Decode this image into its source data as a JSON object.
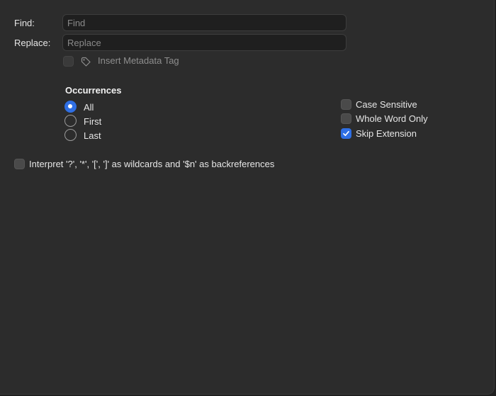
{
  "find": {
    "label": "Find:",
    "placeholder": "Find",
    "value": ""
  },
  "replace": {
    "label": "Replace:",
    "placeholder": "Replace",
    "value": ""
  },
  "metadata_tag": {
    "label": "Insert Metadata Tag",
    "checked": false,
    "enabled": false,
    "icon": "tag-icon"
  },
  "occurrences": {
    "title": "Occurrences",
    "options": [
      "All",
      "First",
      "Last"
    ],
    "selected": "All"
  },
  "options": {
    "case_sensitive": {
      "label": "Case Sensitive",
      "checked": false
    },
    "whole_word_only": {
      "label": "Whole Word Only",
      "checked": false
    },
    "skip_extension": {
      "label": "Skip Extension",
      "checked": true
    }
  },
  "wildcards": {
    "label": "Interpret '?', '*', '[', ']' as wildcards and '$n' as backreferences",
    "checked": false
  },
  "colors": {
    "accent": "#2f6fe4",
    "background": "#2c2c2c",
    "field_background": "#1f1f1f"
  }
}
